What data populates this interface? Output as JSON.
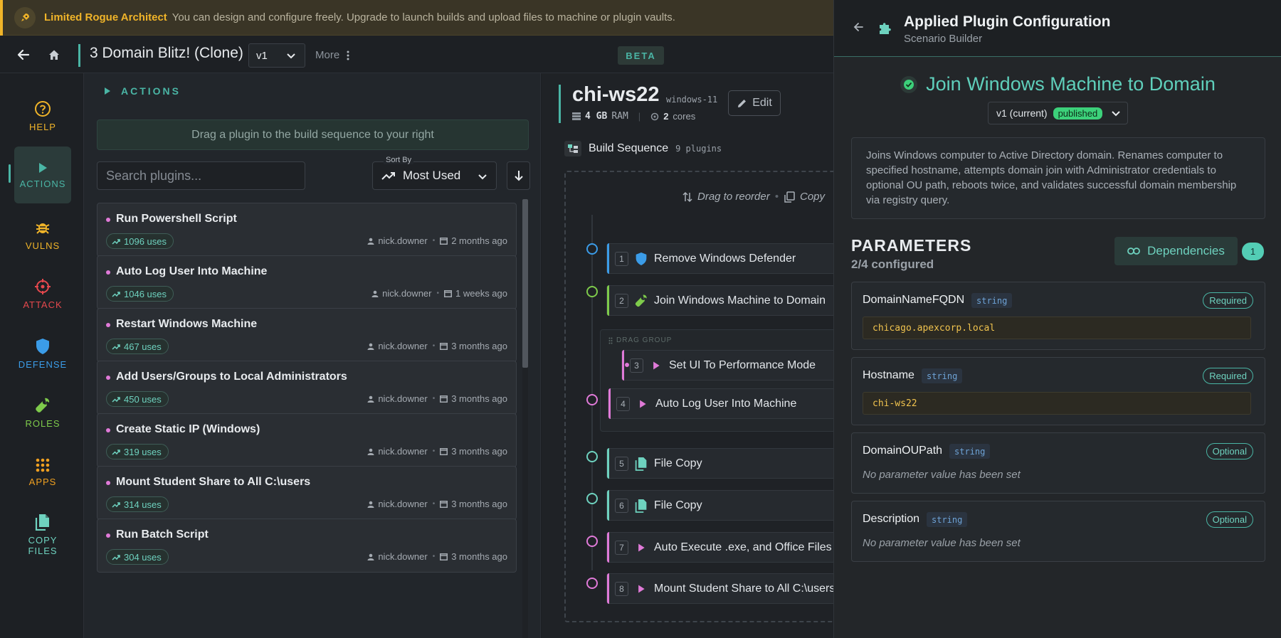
{
  "banner": {
    "tier": "Limited Rogue Architect",
    "message": "You can design and configure freely. Upgrade to launch builds and upload files to machine or plugin vaults."
  },
  "topbar": {
    "scenario_title": "3 Domain Blitz! (Clone)",
    "version": "v1",
    "more_label": "More",
    "beta": "BETA"
  },
  "nav": {
    "items": [
      {
        "label": "HELP",
        "icon": "help-icon",
        "color": "#f0b429"
      },
      {
        "label": "ACTIONS",
        "icon": "play-icon",
        "color": "#4ab5a5",
        "active": true
      },
      {
        "label": "VULNS",
        "icon": "bug-icon",
        "color": "#f0b429"
      },
      {
        "label": "ATTACK",
        "icon": "crosshair-icon",
        "color": "#e5484d"
      },
      {
        "label": "DEFENSE",
        "icon": "shield-icon",
        "color": "#3b9ce8"
      },
      {
        "label": "ROLES",
        "icon": "wrench-icon",
        "color": "#7ecb4b"
      },
      {
        "label": "APPS",
        "icon": "grid-icon",
        "color": "#f0a020"
      },
      {
        "label": "COPY\nFILES",
        "icon": "file-copy-icon",
        "color": "#6ed2bf"
      }
    ]
  },
  "actions": {
    "header": "ACTIONS",
    "drag_hint": "Drag a plugin to the build sequence to your right",
    "search_placeholder": "Search plugins...",
    "sort_label": "Sort By",
    "sort_value": "Most Used",
    "plugins": [
      {
        "name": "Run Powershell Script",
        "uses": "1096 uses",
        "author": "nick.downer",
        "date": "2 months ago"
      },
      {
        "name": "Auto Log User Into Machine",
        "uses": "1046 uses",
        "author": "nick.downer",
        "date": "1 weeks ago"
      },
      {
        "name": "Restart Windows Machine",
        "uses": "467 uses",
        "author": "nick.downer",
        "date": "3 months ago"
      },
      {
        "name": "Add Users/Groups to Local Administrators",
        "uses": "450 uses",
        "author": "nick.downer",
        "date": "3 months ago"
      },
      {
        "name": "Create Static IP (Windows)",
        "uses": "319 uses",
        "author": "nick.downer",
        "date": "3 months ago"
      },
      {
        "name": "Mount Student Share to All C:\\users",
        "uses": "314 uses",
        "author": "nick.downer",
        "date": "3 months ago"
      },
      {
        "name": "Run Batch Script",
        "uses": "304 uses",
        "author": "nick.downer",
        "date": "3 months ago"
      }
    ]
  },
  "machine": {
    "name": "chi-ws22",
    "os": "windows-11",
    "ram": "4 GB",
    "ram_label": "RAM",
    "cores": "2",
    "cores_label": "cores",
    "edit_label": "Edit"
  },
  "build": {
    "title": "Build Sequence",
    "count": "9 plugins",
    "reorder_hint": "Drag to reorder",
    "copy_hint": "Copy",
    "drag_group_label": "DRAG GROUP",
    "steps": [
      {
        "num": "1",
        "name": "Remove Windows Defender",
        "icon": "shield-icon",
        "color": "#3b9ce8"
      },
      {
        "num": "2",
        "name": "Join Windows Machine to Domain",
        "icon": "wrench-icon",
        "color": "#7ecb4b"
      },
      {
        "num": "3",
        "name": "Set UI To Performance Mode",
        "icon": "play-icon",
        "color": "#e07ad8"
      },
      {
        "num": "4",
        "name": "Auto Log User Into Machine",
        "icon": "play-icon",
        "color": "#e07ad8"
      },
      {
        "num": "5",
        "name": "File Copy",
        "icon": "file-copy-icon",
        "color": "#6ed2bf"
      },
      {
        "num": "6",
        "name": "File Copy",
        "icon": "file-copy-icon",
        "color": "#6ed2bf"
      },
      {
        "num": "7",
        "name": "Auto Execute .exe, and Office Files",
        "icon": "play-icon",
        "color": "#e07ad8"
      },
      {
        "num": "8",
        "name": "Mount Student Share to All C:\\users",
        "icon": "play-icon",
        "color": "#e07ad8"
      }
    ]
  },
  "drawer": {
    "title": "Applied Plugin Configuration",
    "subtitle": "Scenario Builder",
    "plugin_title": "Join Windows Machine to Domain",
    "version": "v1 (current)",
    "status": "published",
    "description": "Joins Windows computer to Active Directory domain. Renames computer to specified hostname, attempts domain join with Administrator credentials to optional OU path, reboots twice, and validates successful domain membership via registry query.",
    "params_title": "PARAMETERS",
    "params_count": "2/4 configured",
    "deps_label": "Dependencies",
    "deps_count": "1",
    "params": [
      {
        "name": "DomainNameFQDN",
        "type": "string",
        "required": "Required",
        "value": "chicago.apexcorp.local"
      },
      {
        "name": "Hostname",
        "type": "string",
        "required": "Required",
        "value": "chi-ws22"
      },
      {
        "name": "DomainOUPath",
        "type": "string",
        "required": "Optional",
        "empty": "No parameter value has been set"
      },
      {
        "name": "Description",
        "type": "string",
        "required": "Optional",
        "empty": "No parameter value has been set"
      }
    ]
  }
}
